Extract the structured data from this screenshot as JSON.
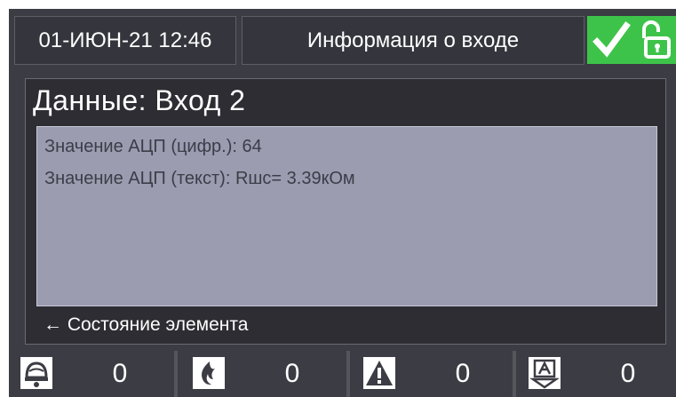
{
  "header": {
    "datetime": "01-ИЮН-21 12:46",
    "title": "Информация о входе",
    "status_icons": [
      "check-icon",
      "unlock-icon"
    ],
    "status_color": "#3ec34a"
  },
  "panel": {
    "title": "Данные: Вход 2",
    "lines": [
      "Значение АЦП (цифр.): 64",
      "Значение АЦП (текст): Rшс= 3.39кОм"
    ],
    "footer": "← Состояние элемента"
  },
  "counters": [
    {
      "icon": "fire-alarm-bell-icon",
      "value": "0"
    },
    {
      "icon": "flame-icon",
      "value": "0"
    },
    {
      "icon": "warning-triangle-icon",
      "value": "0"
    },
    {
      "icon": "fault-arrow-icon",
      "value": "0"
    }
  ]
}
